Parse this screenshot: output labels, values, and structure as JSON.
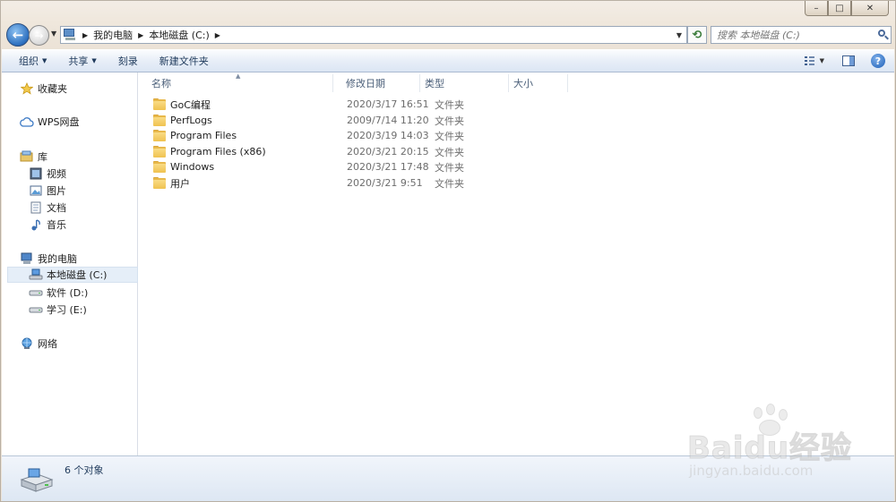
{
  "window": {
    "minimize_glyph": "–",
    "maximize_glyph": "□",
    "close_glyph": "✕"
  },
  "nav": {
    "back_glyph": "←",
    "forward_glyph": "→",
    "history_glyph": "▼",
    "breadcrumb": [
      "我的电脑",
      "本地磁盘 (C:)"
    ],
    "crumb_sep_glyph": "▶",
    "dropdown_glyph": "▼",
    "refresh_glyph": "⟲"
  },
  "search": {
    "placeholder": "搜索 本地磁盘 (C:)"
  },
  "toolbar": {
    "organize_label": "组织",
    "share_label": "共享",
    "burn_label": "刻录",
    "new_folder_label": "新建文件夹",
    "caret_glyph": "▼",
    "help_glyph": "?"
  },
  "sidebar": {
    "favorites": "收藏夹",
    "wps": "WPS网盘",
    "library": "库",
    "library_items": [
      "视频",
      "图片",
      "文档",
      "音乐"
    ],
    "computer": "我的电脑",
    "drives": [
      "本地磁盘 (C:)",
      "软件 (D:)",
      "学习 (E:)"
    ],
    "network": "网络"
  },
  "columns": {
    "name": "名称",
    "date": "修改日期",
    "type": "类型",
    "size": "大小",
    "sort_glyph": "▲"
  },
  "files": [
    {
      "name": "GoC编程",
      "date": "2020/3/17 16:51",
      "type": "文件夹"
    },
    {
      "name": "PerfLogs",
      "date": "2009/7/14 11:20",
      "type": "文件夹"
    },
    {
      "name": "Program Files",
      "date": "2020/3/19 14:03",
      "type": "文件夹"
    },
    {
      "name": "Program Files (x86)",
      "date": "2020/3/21 20:15",
      "type": "文件夹"
    },
    {
      "name": "Windows",
      "date": "2020/3/21 17:48",
      "type": "文件夹"
    },
    {
      "name": "用户",
      "date": "2020/3/21 9:51",
      "type": "文件夹"
    }
  ],
  "status": {
    "count": "6 个对象"
  },
  "watermark": {
    "brand": "Baidu经验",
    "url": "jingyan.baidu.com"
  }
}
